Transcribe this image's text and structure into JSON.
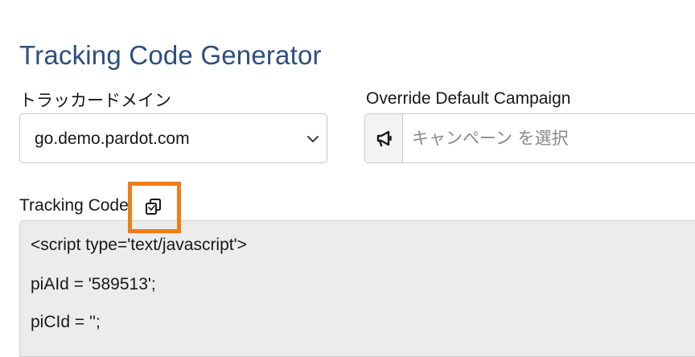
{
  "page": {
    "title": "Tracking Code Generator"
  },
  "domain_field": {
    "label": "トラッカードメイン",
    "selected_value": "go.demo.pardot.com",
    "icon": "chevron-down-icon"
  },
  "campaign_field": {
    "label": "Override Default Campaign",
    "placeholder": "キャンペーン を選択",
    "value": "",
    "prefix_icon": "megaphone-icon"
  },
  "tracking_code": {
    "label": "Tracking Code",
    "copy_icon": "copy-icon",
    "highlight_color": "#ef7d18",
    "lines": [
      "<script type='text/javascript'>",
      "piAId = '589513';",
      "piCId = '';"
    ]
  },
  "colors": {
    "title": "#2e4e7e",
    "code_background": "#ececec",
    "highlight": "#ef7d18"
  }
}
